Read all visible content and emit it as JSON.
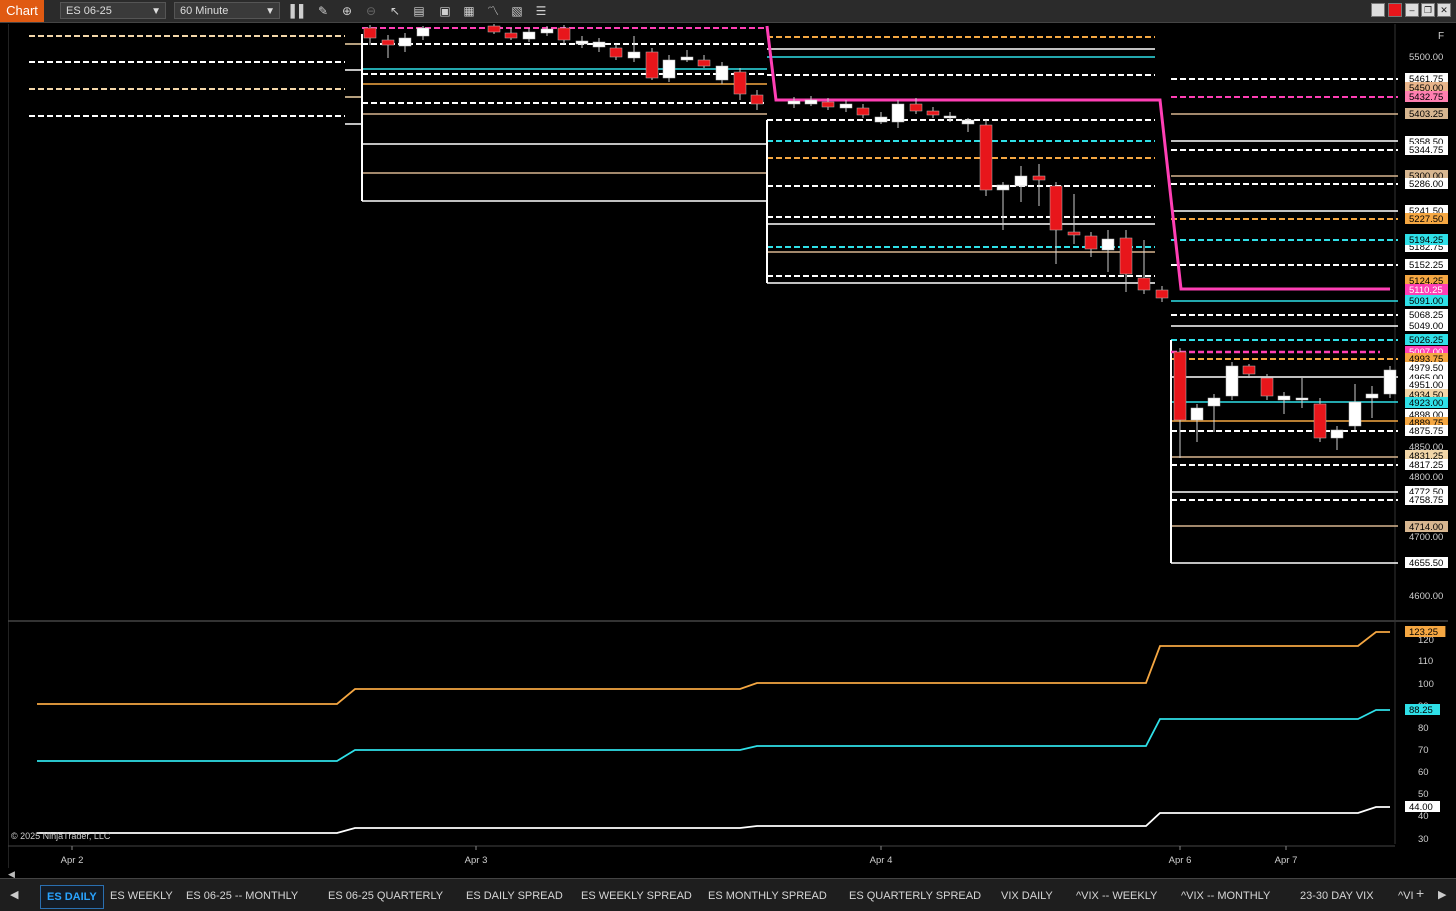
{
  "toolbar": {
    "title": "Chart",
    "instrument": "ES 06-25",
    "interval": "60 Minute",
    "icons": [
      "bar-type-icon",
      "draw-pencil-icon",
      "zoom-in-icon",
      "zoom-out-icon",
      "pointer-icon",
      "data-box-icon",
      "properties-icon",
      "strategies-icon",
      "indicators-icon",
      "templates-icon",
      "list-icon"
    ]
  },
  "chart": {
    "price_scale_mark": "F",
    "copyright": "© 2025 NinjaTrader, LLC",
    "time_labels": [
      "Apr 2",
      "Apr 3",
      "Apr 4",
      "Apr 6",
      "Apr 7"
    ],
    "price_ticks": [
      "5500.00",
      "4700.00",
      "4600.00",
      "4800.00",
      "4850.00"
    ],
    "price_labels": [
      {
        "text": "5461.75",
        "bg": "#ffffff",
        "fg": "#000000"
      },
      {
        "text": "5450.00",
        "bg": "#e8b48a",
        "fg": "#000000"
      },
      {
        "text": "5432.75",
        "bg": "#ff7fb0",
        "fg": "#000000"
      },
      {
        "text": "5403.25",
        "bg": "#d7b690",
        "fg": "#000000"
      },
      {
        "text": "5358.50",
        "bg": "#ffffff",
        "fg": "#000000"
      },
      {
        "text": "5344.75",
        "bg": "#ffffff",
        "fg": "#000000"
      },
      {
        "text": "5300.00",
        "bg": "#d7b690",
        "fg": "#000000"
      },
      {
        "text": "5286.00",
        "bg": "#ffffff",
        "fg": "#000000"
      },
      {
        "text": "5241.50",
        "bg": "#ffffff",
        "fg": "#000000"
      },
      {
        "text": "5227.50",
        "bg": "#f5a742",
        "fg": "#000000"
      },
      {
        "text": "5182.75",
        "bg": "#ffffff",
        "fg": "#000000"
      },
      {
        "text": "5194.25",
        "bg": "#2fe0e8",
        "fg": "#000000"
      },
      {
        "text": "5152.25",
        "bg": "#ffffff",
        "fg": "#000000"
      },
      {
        "text": "5124.25",
        "bg": "#f5a742",
        "fg": "#000000"
      },
      {
        "text": "5110.25",
        "bg": "#ff3fb5",
        "fg": "#ffffff"
      },
      {
        "text": "5091.00",
        "bg": "#2fe0e8",
        "fg": "#000000"
      },
      {
        "text": "5068.25",
        "bg": "#ffffff",
        "fg": "#000000"
      },
      {
        "text": "5049.00",
        "bg": "#ffffff",
        "fg": "#000000"
      },
      {
        "text": "5026.25",
        "bg": "#2fe0e8",
        "fg": "#000000"
      },
      {
        "text": "5007.00",
        "bg": "#ff3fb5",
        "fg": "#ffffff"
      },
      {
        "text": "4993.75",
        "bg": "#f5a742",
        "fg": "#000000"
      },
      {
        "text": "4979.50",
        "bg": "#ffffff",
        "fg": "#000000"
      },
      {
        "text": "4965.00",
        "bg": "#ffffff",
        "fg": "#000000"
      },
      {
        "text": "4951.00",
        "bg": "#ffffff",
        "fg": "#000000"
      },
      {
        "text": "4934.50",
        "bg": "#f2d6a8",
        "fg": "#000000"
      },
      {
        "text": "4923.00",
        "bg": "#2fe0e8",
        "fg": "#000000"
      },
      {
        "text": "4898.00",
        "bg": "#ffffff",
        "fg": "#000000"
      },
      {
        "text": "4889.75",
        "bg": "#f5a742",
        "fg": "#000000"
      },
      {
        "text": "4875.75",
        "bg": "#ffffff",
        "fg": "#000000"
      },
      {
        "text": "4831.25",
        "bg": "#f2d6a8",
        "fg": "#000000"
      },
      {
        "text": "4817.25",
        "bg": "#ffffff",
        "fg": "#000000"
      },
      {
        "text": "4772.50",
        "bg": "#ffffff",
        "fg": "#000000"
      },
      {
        "text": "4758.75",
        "bg": "#ffffff",
        "fg": "#000000"
      },
      {
        "text": "4714.00",
        "bg": "#d7b690",
        "fg": "#000000"
      },
      {
        "text": "4655.50",
        "bg": "#ffffff",
        "fg": "#000000"
      }
    ],
    "lower_ticks": [
      "120",
      "110",
      "100",
      "90",
      "80",
      "70",
      "60",
      "50",
      "40",
      "30"
    ],
    "lower_labels": [
      {
        "text": "123.25",
        "bg": "#f5a742",
        "fg": "#000000"
      },
      {
        "text": "88.25",
        "bg": "#2fe0e8",
        "fg": "#000000"
      },
      {
        "text": "44.00",
        "bg": "#ffffff",
        "fg": "#000000"
      }
    ],
    "colors": {
      "up_candle": "#ffffff",
      "down_candle": "#e8161b",
      "white_level": "#ffffff",
      "cyan_level": "#2fe0e8",
      "orange_level": "#f5a742",
      "tan_level": "#d7b690",
      "magenta_level": "#ff3fb5",
      "background": "#000000"
    }
  },
  "tabs": {
    "items": [
      "ES DAILY",
      "ES WEEKLY",
      "ES 06-25 -- MONTHLY",
      "ES 06-25 QUARTERLY",
      "ES DAILY SPREAD",
      "ES WEEKLY SPREAD",
      "ES MONTHLY SPREAD",
      "ES QUARTERLY SPREAD",
      "VIX DAILY",
      "^VIX -- WEEKLY",
      "^VIX -- MONTHLY",
      "23-30 DAY VIX",
      "^VI"
    ],
    "active": "ES DAILY",
    "add_label": "+"
  }
}
